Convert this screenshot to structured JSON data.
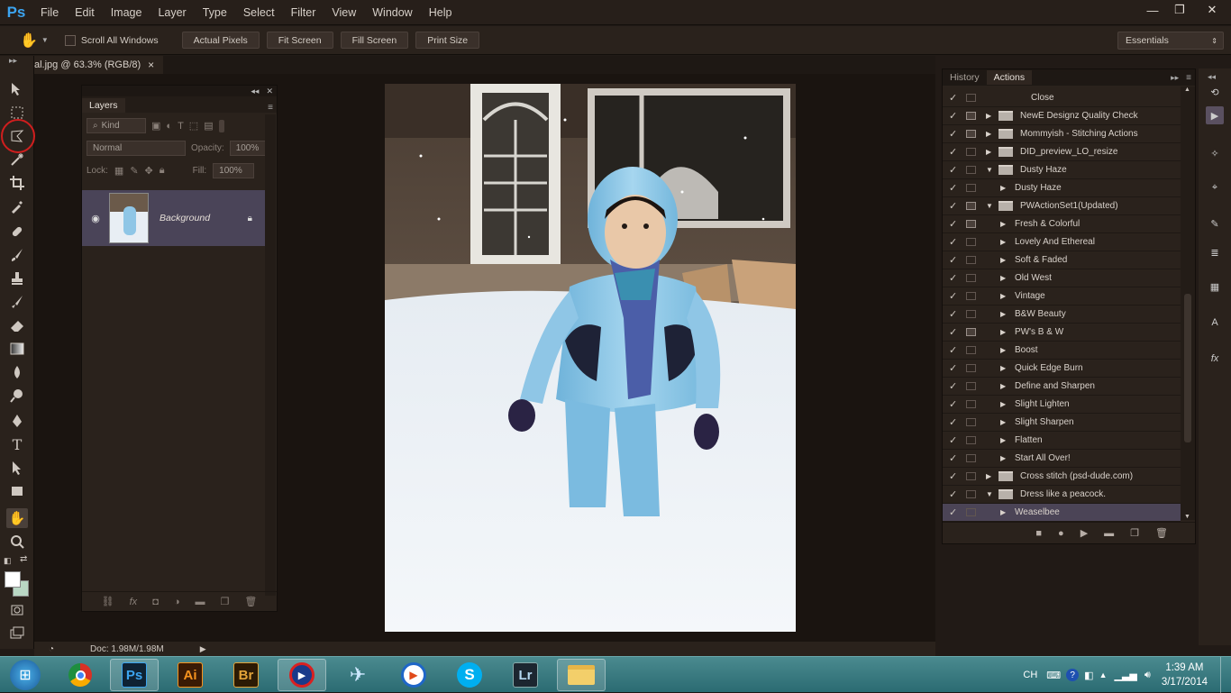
{
  "app": {
    "logo": "Ps"
  },
  "menu": [
    "File",
    "Edit",
    "Image",
    "Layer",
    "Type",
    "Select",
    "Filter",
    "View",
    "Window",
    "Help"
  ],
  "window_controls": {
    "minimize": "—",
    "restore": "❐",
    "close": "✕"
  },
  "options_bar": {
    "scroll_all_windows": "Scroll All Windows",
    "actual_pixels": "Actual Pixels",
    "fit_screen": "Fit Screen",
    "fill_screen": "Fill Screen",
    "print_size": "Print Size",
    "workspace": "Essentials"
  },
  "document": {
    "tab_title": "al.jpg @ 63.3% (RGB/8)",
    "close": "×"
  },
  "layers_panel": {
    "tab": "Layers",
    "kind": "Kind",
    "blend_mode": "Normal",
    "opacity_label": "Opacity:",
    "opacity": "100%",
    "lock_label": "Lock:",
    "fill_label": "Fill:",
    "fill": "100%",
    "layer_name": "Background"
  },
  "actions_panel": {
    "tabs": [
      "History",
      "Actions"
    ],
    "rows": [
      {
        "label": "Close",
        "level": 2,
        "check": true,
        "dialog": false,
        "expand": "none"
      },
      {
        "label": "NewE Designz Quality Check",
        "level": 0,
        "check": true,
        "dialog": true,
        "expand": "closed"
      },
      {
        "label": "Mommyish - Stitching Actions",
        "level": 0,
        "check": true,
        "dialog": true,
        "expand": "closed"
      },
      {
        "label": "DID_preview_LO_resize",
        "level": 0,
        "check": true,
        "dialog": false,
        "expand": "closed"
      },
      {
        "label": "Dusty Haze",
        "level": 0,
        "check": true,
        "dialog": false,
        "expand": "open"
      },
      {
        "label": "Dusty Haze",
        "level": 1,
        "check": true,
        "dialog": false,
        "expand": "closed"
      },
      {
        "label": "PWActionSet1(Updated)",
        "level": 0,
        "check": true,
        "dialog": true,
        "expand": "open"
      },
      {
        "label": "Fresh & Colorful",
        "level": 1,
        "check": true,
        "dialog": true,
        "expand": "closed"
      },
      {
        "label": "Lovely And Ethereal",
        "level": 1,
        "check": true,
        "dialog": false,
        "expand": "closed"
      },
      {
        "label": "Soft & Faded",
        "level": 1,
        "check": true,
        "dialog": false,
        "expand": "closed"
      },
      {
        "label": "Old West",
        "level": 1,
        "check": true,
        "dialog": false,
        "expand": "closed"
      },
      {
        "label": "Vintage",
        "level": 1,
        "check": true,
        "dialog": false,
        "expand": "closed"
      },
      {
        "label": "B&W Beauty",
        "level": 1,
        "check": true,
        "dialog": false,
        "expand": "closed"
      },
      {
        "label": "PW's B & W",
        "level": 1,
        "check": true,
        "dialog": true,
        "expand": "closed"
      },
      {
        "label": "Boost",
        "level": 1,
        "check": true,
        "dialog": false,
        "expand": "closed"
      },
      {
        "label": "Quick Edge Burn",
        "level": 1,
        "check": true,
        "dialog": false,
        "expand": "closed"
      },
      {
        "label": "Define and Sharpen",
        "level": 1,
        "check": true,
        "dialog": false,
        "expand": "closed"
      },
      {
        "label": "Slight Lighten",
        "level": 1,
        "check": true,
        "dialog": false,
        "expand": "closed"
      },
      {
        "label": "Slight Sharpen",
        "level": 1,
        "check": true,
        "dialog": false,
        "expand": "closed"
      },
      {
        "label": "Flatten",
        "level": 1,
        "check": true,
        "dialog": false,
        "expand": "closed"
      },
      {
        "label": "Start All Over!",
        "level": 1,
        "check": true,
        "dialog": false,
        "expand": "closed"
      },
      {
        "label": "Cross stitch (psd-dude.com)",
        "level": 0,
        "check": true,
        "dialog": false,
        "expand": "closed"
      },
      {
        "label": "Dress like a peacock.",
        "level": 0,
        "check": true,
        "dialog": false,
        "expand": "open"
      },
      {
        "label": "Weaselbee",
        "level": 1,
        "check": true,
        "dialog": false,
        "expand": "closed",
        "selected": true
      }
    ]
  },
  "status": {
    "doc": "Doc: 1.98M/1.98M"
  },
  "taskbar": {
    "apps": [
      "start-button",
      "chrome",
      "photoshop",
      "illustrator",
      "bridge",
      "quicktime",
      "bird-app",
      "media-player",
      "skype",
      "lightroom",
      "file-explorer"
    ],
    "illustrator": "Ai",
    "bridge": "Br",
    "lightroom": "Lr",
    "photoshop": "Ps",
    "lang": "CH",
    "time": "1:39 AM",
    "date": "3/17/2014"
  }
}
